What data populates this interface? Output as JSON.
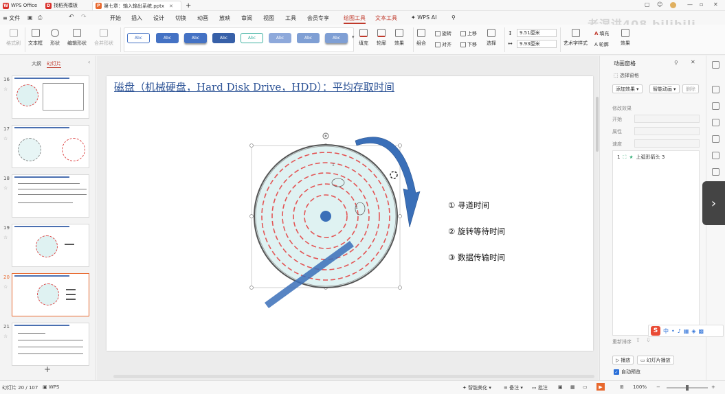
{
  "titlebar": {
    "app_tab": "WPS Office",
    "template_tab": "找稻壳模板",
    "doc_tab": "第七章：输入输出系统.pptx",
    "new_tab": "+"
  },
  "menu": {
    "file": "文件",
    "items": [
      "开始",
      "插入",
      "设计",
      "切换",
      "动画",
      "放映",
      "审阅",
      "视图",
      "工具",
      "会员专享"
    ],
    "drawing_tools": "绘图工具",
    "text_tools": "文本工具",
    "wps_ai": "WPS AI"
  },
  "ribbon": {
    "format_painter": "格式刷",
    "textbox": "文本框",
    "shape": "形状",
    "edit_shape": "编辑形状",
    "merge_shape": "合并形状",
    "style_label": "Abc",
    "fill": "填充",
    "outline": "轮廓",
    "effect": "效果",
    "rotate": "旋转",
    "group": "组合",
    "align": "对齐",
    "bring_forward": "上移",
    "send_backward": "下移",
    "select": "选择",
    "height_value": "9.51厘米",
    "width_value": "9.93厘米",
    "art_text": "艺术字样式",
    "text_fill": "填充",
    "text_outline": "轮廓",
    "text_effect": "效果"
  },
  "left_panel": {
    "outline_tab": "大纲",
    "slides_tab": "幻灯片",
    "slide_numbers": [
      "16",
      "17",
      "18",
      "19",
      "20",
      "21"
    ],
    "selected": "20",
    "add": "+"
  },
  "slide": {
    "title": "磁盘（机械硬盘，Hard Disk Drive，HDD）：平均存取时间",
    "bullets": [
      "① 寻道时间",
      "② 旋转等待时间",
      "③ 数据传输时间"
    ]
  },
  "right_panel": {
    "title": "动画窗格",
    "select_pane": "选择窗格",
    "add_effect": "添加效果",
    "smart_anim": "智能动画",
    "delete": "删除",
    "modify_effect": "修改效果",
    "start_label": "开始",
    "property_label": "属性",
    "speed_label": "速度",
    "anim_item_num": "1",
    "anim_item": "上弧形箭头 3",
    "reorder": "重新排序",
    "play": "播放",
    "slideshow": "幻灯片播放",
    "auto_preview": "自动预览"
  },
  "ime": {
    "logo": "S",
    "lang": "中"
  },
  "statusbar": {
    "slide_info": "幻灯片 20 / 107",
    "wps": "WPS",
    "smart_beautify": "智能美化",
    "notes": "备注",
    "comments": "批注",
    "zoom": "100%"
  },
  "watermark": "老湿讲408 bilibili",
  "colors": {
    "accent": "#c0392b",
    "orange": "#e8682d",
    "title_blue": "#2f5597",
    "arrow_blue": "#3a6fb8"
  }
}
